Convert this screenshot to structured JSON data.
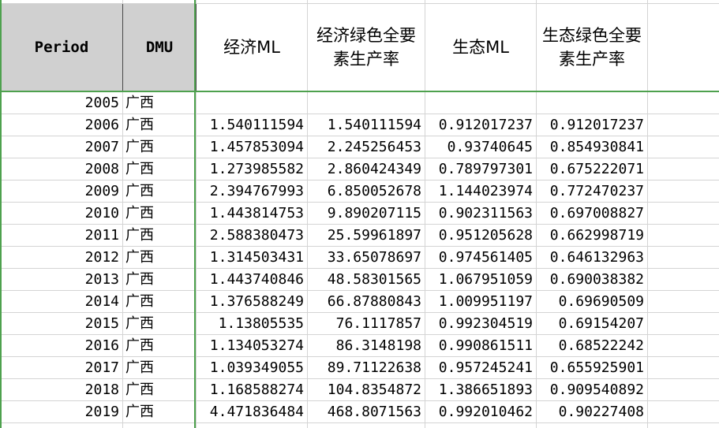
{
  "colors": {
    "selection_green": "#4ea14e",
    "header_fill": "#d0d0d0",
    "gridline": "#d4d4d4"
  },
  "header": {
    "period": "Period",
    "dmu": "DMU",
    "econ_ml": "经济ML",
    "econ_gtfp": "经济绿色全要素生产率",
    "eco_ml": "生态ML",
    "eco_gtfp": "生态绿色全要素生产率"
  },
  "rows": [
    {
      "period": "2005",
      "dmu": "广西",
      "econ_ml": "",
      "econ_gtfp": "",
      "eco_ml": "",
      "eco_gtfp": ""
    },
    {
      "period": "2006",
      "dmu": "广西",
      "econ_ml": "1.540111594",
      "econ_gtfp": "1.540111594",
      "eco_ml": "0.912017237",
      "eco_gtfp": "0.912017237"
    },
    {
      "period": "2007",
      "dmu": "广西",
      "econ_ml": "1.457853094",
      "econ_gtfp": "2.245256453",
      "eco_ml": "0.93740645",
      "eco_gtfp": "0.854930841"
    },
    {
      "period": "2008",
      "dmu": "广西",
      "econ_ml": "1.273985582",
      "econ_gtfp": "2.860424349",
      "eco_ml": "0.789797301",
      "eco_gtfp": "0.675222071"
    },
    {
      "period": "2009",
      "dmu": "广西",
      "econ_ml": "2.394767993",
      "econ_gtfp": "6.850052678",
      "eco_ml": "1.144023974",
      "eco_gtfp": "0.772470237"
    },
    {
      "period": "2010",
      "dmu": "广西",
      "econ_ml": "1.443814753",
      "econ_gtfp": "9.890207115",
      "eco_ml": "0.902311563",
      "eco_gtfp": "0.697008827"
    },
    {
      "period": "2011",
      "dmu": "广西",
      "econ_ml": "2.588380473",
      "econ_gtfp": "25.59961897",
      "eco_ml": "0.951205628",
      "eco_gtfp": "0.662998719"
    },
    {
      "period": "2012",
      "dmu": "广西",
      "econ_ml": "1.314503431",
      "econ_gtfp": "33.65078697",
      "eco_ml": "0.974561405",
      "eco_gtfp": "0.646132963"
    },
    {
      "period": "2013",
      "dmu": "广西",
      "econ_ml": "1.443740846",
      "econ_gtfp": "48.58301565",
      "eco_ml": "1.067951059",
      "eco_gtfp": "0.690038382"
    },
    {
      "period": "2014",
      "dmu": "广西",
      "econ_ml": "1.376588249",
      "econ_gtfp": "66.87880843",
      "eco_ml": "1.009951197",
      "eco_gtfp": "0.69690509"
    },
    {
      "period": "2015",
      "dmu": "广西",
      "econ_ml": "1.13805535",
      "econ_gtfp": "76.1117857",
      "eco_ml": "0.992304519",
      "eco_gtfp": "0.69154207"
    },
    {
      "period": "2016",
      "dmu": "广西",
      "econ_ml": "1.134053274",
      "econ_gtfp": "86.3148198",
      "eco_ml": "0.990861511",
      "eco_gtfp": "0.68522242"
    },
    {
      "period": "2017",
      "dmu": "广西",
      "econ_ml": "1.039349055",
      "econ_gtfp": "89.71122638",
      "eco_ml": "0.957245241",
      "eco_gtfp": "0.655925901"
    },
    {
      "period": "2018",
      "dmu": "广西",
      "econ_ml": "1.168588274",
      "econ_gtfp": "104.8354872",
      "eco_ml": "1.386651893",
      "eco_gtfp": "0.909540892"
    },
    {
      "period": "2019",
      "dmu": "广西",
      "econ_ml": "4.471836484",
      "econ_gtfp": "468.8071563",
      "eco_ml": "0.992010462",
      "eco_gtfp": "0.90227408"
    }
  ]
}
